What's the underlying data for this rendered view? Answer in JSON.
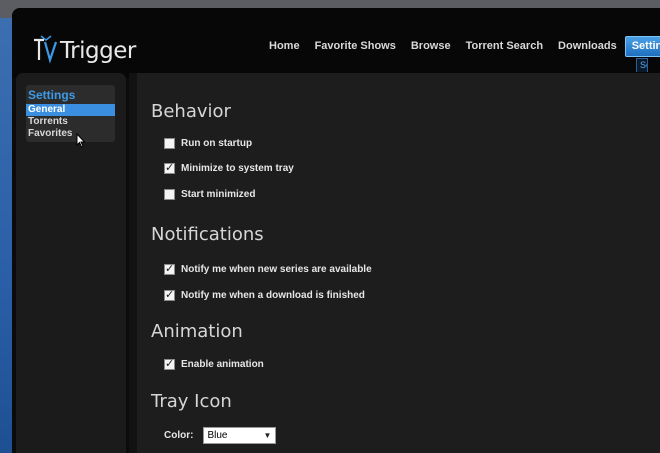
{
  "app": {
    "logo_text": "Trigger"
  },
  "nav": {
    "items": [
      {
        "label": "Home"
      },
      {
        "label": "Favorite Shows"
      },
      {
        "label": "Browse"
      },
      {
        "label": "Torrent Search"
      },
      {
        "label": "Downloads"
      },
      {
        "label": "Settings",
        "active": true
      }
    ],
    "partial_tab": "Se"
  },
  "sidebar": {
    "title": "Settings",
    "items": [
      {
        "label": "General",
        "selected": true
      },
      {
        "label": "Torrents"
      },
      {
        "label": "Favorites"
      }
    ]
  },
  "sections": {
    "behavior": {
      "title": "Behavior",
      "options": [
        {
          "label": "Run on startup",
          "checked": false
        },
        {
          "label": "Minimize to system tray",
          "checked": true
        },
        {
          "label": "Start minimized",
          "checked": false
        }
      ]
    },
    "notifications": {
      "title": "Notifications",
      "options": [
        {
          "label": "Notify me when new series are available",
          "checked": true
        },
        {
          "label": "Notify me when a download is finished",
          "checked": true
        }
      ]
    },
    "animation": {
      "title": "Animation",
      "options": [
        {
          "label": "Enable animation",
          "checked": true
        }
      ]
    },
    "tray_icon": {
      "title": "Tray Icon",
      "color_label": "Color:",
      "color_value": "Blue"
    }
  },
  "colors": {
    "accent": "#3a8fe0",
    "active_tab": "#1e6fc0",
    "content_bg": "#1d1d1d"
  }
}
